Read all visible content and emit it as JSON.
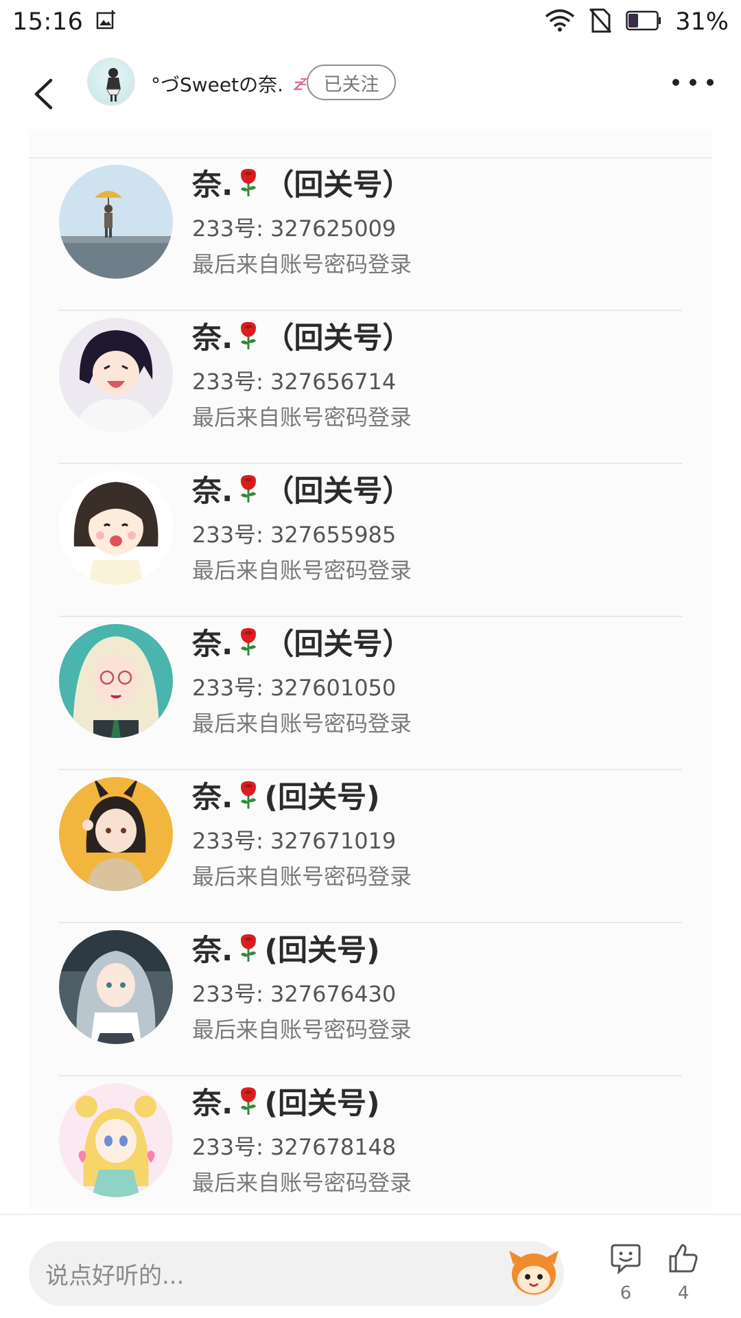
{
  "status": {
    "time": "15:16",
    "battery_pct": "31%"
  },
  "header": {
    "author_name": "°づSweetの奈.",
    "follow_label": "已关注"
  },
  "accounts": [
    {
      "name": "奈.",
      "suffix": " （回关号）",
      "id": "233号: 327625009",
      "login": "最后来自账号密码登录",
      "avatar": "umbrella-girl-avatar"
    },
    {
      "name": "奈.",
      "suffix": " （回关号）",
      "id": "233号: 327656714",
      "login": "最后来自账号密码登录",
      "avatar": "laughing-anime-boy-avatar"
    },
    {
      "name": "奈.",
      "suffix": " （回关号）",
      "id": "233号: 327655985",
      "login": "最后来自账号密码登录",
      "avatar": "happy-chibi-girl-avatar"
    },
    {
      "name": "奈.",
      "suffix": " （回关号）",
      "id": "233号: 327601050",
      "login": "最后来自账号密码登录",
      "avatar": "blonde-glasses-girl-avatar"
    },
    {
      "name": "奈.",
      "suffix": "(回关号)",
      "id": "233号: 327671019",
      "login": "最后来自账号密码登录",
      "avatar": "bunny-ear-girl-avatar"
    },
    {
      "name": "奈.",
      "suffix": "(回关号)",
      "id": "233号: 327676430",
      "login": "最后来自账号密码登录",
      "avatar": "silver-hair-girl-avatar"
    },
    {
      "name": "奈.",
      "suffix": "(回关号)",
      "id": "233号: 327678148",
      "login": "最后来自账号密码登录",
      "avatar": "sailor-moon-avatar"
    }
  ],
  "bottom": {
    "comment_placeholder": "说点好听的...",
    "comment_count": "6",
    "like_count": "4"
  },
  "colors": {
    "rose": "#d81e1e",
    "leaf": "#2e8b3a",
    "divider": "#e8e8e8"
  }
}
